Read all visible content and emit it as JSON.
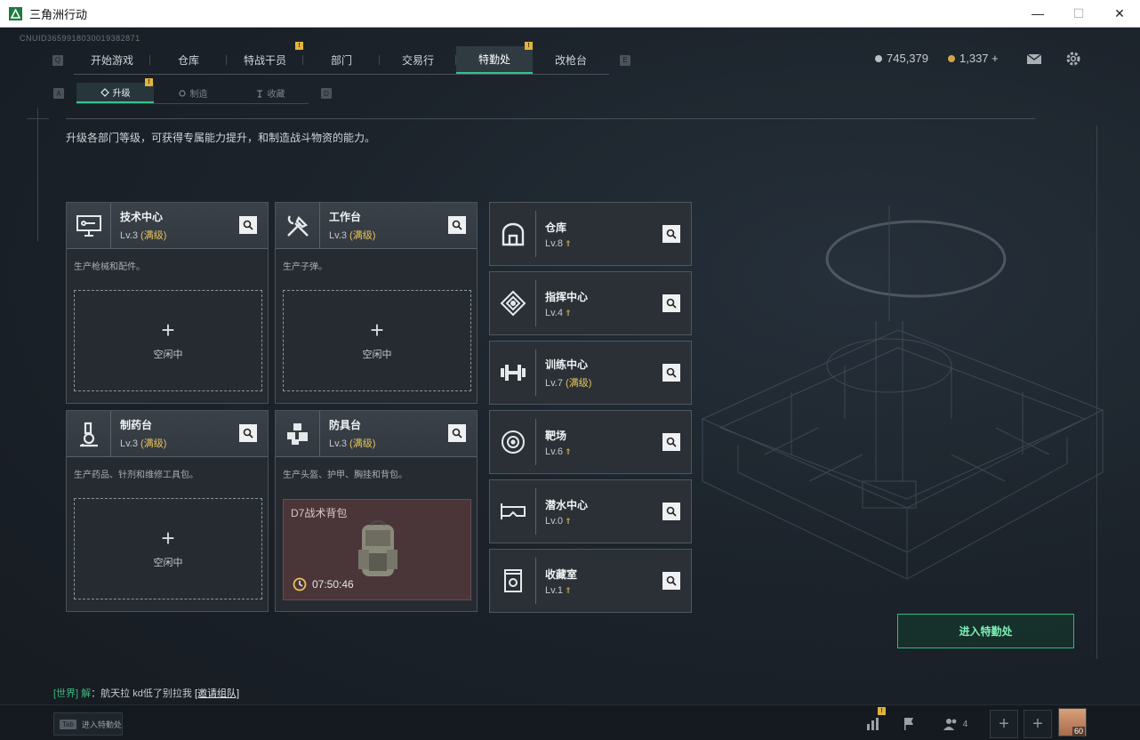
{
  "window": {
    "title": "三角洲行动",
    "controls": [
      "—",
      "☐",
      "✕"
    ]
  },
  "uid": "CNUID3659918030019382871",
  "nav": {
    "left_key": "Q",
    "right_key": "E",
    "tabs": [
      "开始游戏",
      "仓库",
      "特战干员",
      "部门",
      "交易行",
      "特勤处",
      "改枪台"
    ],
    "active_tab": "特勤处",
    "badge": "!"
  },
  "subnav": {
    "left_key": "A",
    "right_key": "D",
    "tabs": [
      "升级",
      "制造",
      "收藏"
    ]
  },
  "currency": {
    "silver": "745,379",
    "gold": "1,337 +"
  },
  "description": "升级各部门等级，可获得专属能力提升，和制造战斗物资的能力。",
  "workshops": [
    {
      "name": "技术中心",
      "lv": "Lv.3",
      "max": "(满级)",
      "desc": "生产枪械和配件。",
      "slot": "空闲中",
      "icon": "monitor-icon"
    },
    {
      "name": "工作台",
      "lv": "Lv.3",
      "max": "(满级)",
      "desc": "生产子弹。",
      "slot": "空闲中",
      "icon": "tools-icon"
    },
    {
      "name": "制药台",
      "lv": "Lv.3",
      "max": "(满级)",
      "desc": "生产药品、针剂和维修工具包。",
      "slot": "空闲中",
      "icon": "microscope-icon"
    },
    {
      "name": "防具台",
      "lv": "Lv.3",
      "max": "(满级)",
      "desc": "生产头盔、护甲、胸挂和背包。",
      "icon": "armor-icon",
      "production": {
        "item": "D7战术背包",
        "time": "07:50:46"
      }
    }
  ],
  "facilities": [
    {
      "name": "仓库",
      "lv": "Lv.8",
      "upgrade": true,
      "icon": "warehouse-icon"
    },
    {
      "name": "指挥中心",
      "lv": "Lv.4",
      "upgrade": true,
      "icon": "command-icon"
    },
    {
      "name": "训练中心",
      "lv": "Lv.7",
      "max": "(满级)",
      "upgrade": false,
      "icon": "dumbbell-icon"
    },
    {
      "name": "靶场",
      "lv": "Lv.6",
      "upgrade": true,
      "icon": "target-icon"
    },
    {
      "name": "潜水中心",
      "lv": "Lv.0",
      "upgrade": true,
      "icon": "diving-mask-icon"
    },
    {
      "name": "收藏室",
      "lv": "Lv.1",
      "upgrade": true,
      "icon": "collection-icon"
    }
  ],
  "enter_button": "进入特勤处",
  "chat": {
    "channel": "[世界]",
    "user": "解",
    "message": "：航天拉 kd低了别拉我",
    "invite": "[邀请组队]"
  },
  "bottom": {
    "tab_key": "Tab",
    "tab_label": "进入特勤处",
    "friends_count": "4",
    "avatar_level": "60",
    "badge": "!"
  }
}
